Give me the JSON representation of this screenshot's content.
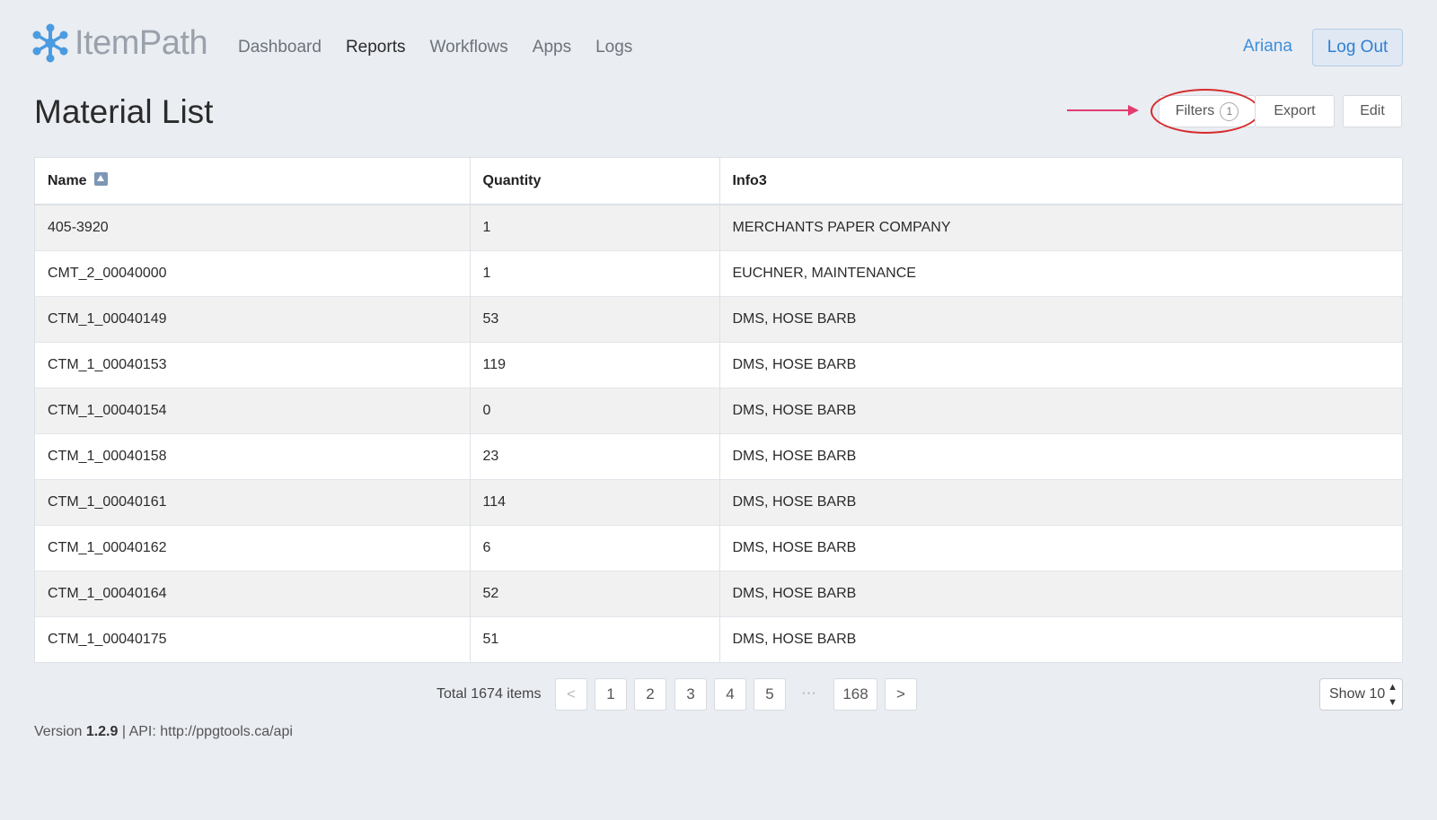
{
  "header": {
    "logo_text": "ItemPath",
    "nav": [
      {
        "label": "Dashboard",
        "active": false
      },
      {
        "label": "Reports",
        "active": true
      },
      {
        "label": "Workflows",
        "active": false
      },
      {
        "label": "Apps",
        "active": false
      },
      {
        "label": "Logs",
        "active": false
      }
    ],
    "user": "Ariana",
    "logout_label": "Log Out"
  },
  "page": {
    "title": "Material List",
    "filters_label": "Filters",
    "filters_count": "1",
    "export_label": "Export",
    "edit_label": "Edit"
  },
  "table": {
    "columns": [
      "Name",
      "Quantity",
      "Info3"
    ],
    "rows": [
      [
        "405-3920",
        "1",
        "MERCHANTS PAPER COMPANY"
      ],
      [
        "CMT_2_00040000",
        "1",
        "EUCHNER, MAINTENANCE"
      ],
      [
        "CTM_1_00040149",
        "53",
        "DMS, HOSE BARB"
      ],
      [
        "CTM_1_00040153",
        "119",
        "DMS, HOSE BARB"
      ],
      [
        "CTM_1_00040154",
        "0",
        "DMS, HOSE BARB"
      ],
      [
        "CTM_1_00040158",
        "23",
        "DMS, HOSE BARB"
      ],
      [
        "CTM_1_00040161",
        "114",
        "DMS, HOSE BARB"
      ],
      [
        "CTM_1_00040162",
        "6",
        "DMS, HOSE BARB"
      ],
      [
        "CTM_1_00040164",
        "52",
        "DMS, HOSE BARB"
      ],
      [
        "CTM_1_00040175",
        "51",
        "DMS, HOSE BARB"
      ]
    ]
  },
  "pagination": {
    "total": "Total 1674 items",
    "prev": "<",
    "pages": [
      "1",
      "2",
      "3",
      "4",
      "5"
    ],
    "ellipsis": "···",
    "last": "168",
    "next": ">",
    "show": "Show 10"
  },
  "footer": {
    "version_prefix": "Version ",
    "version": "1.2.9",
    "api_text": " | API: http://ppgtools.ca/api"
  },
  "colors": {
    "accent": "#3d8fdc",
    "highlight": "#d62b2b",
    "arrow": "#e23b6e",
    "background": "#eaedf2"
  }
}
